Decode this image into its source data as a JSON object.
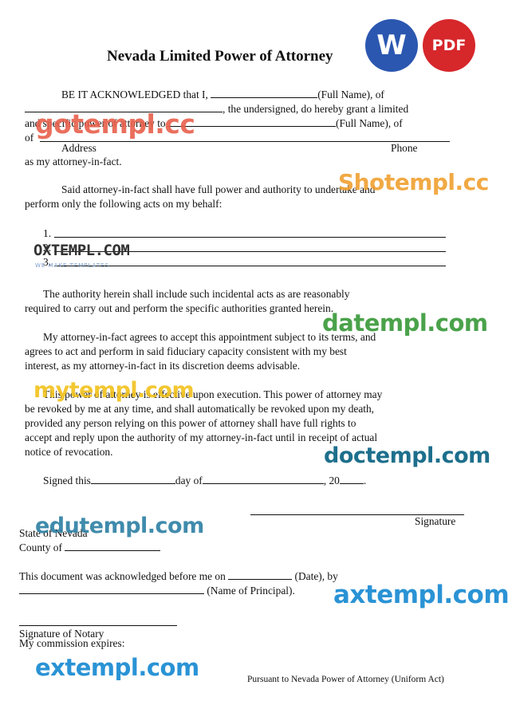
{
  "doc": {
    "title": "Nevada Limited Power of Attorney",
    "p1_a": "BE IT ACKNOWLEDGED   that I,",
    "p1_b": "(Full Name), of",
    "p1_c": ", the undersigned, do hereby grant a limited",
    "p1_d": "and specific power of attorney to",
    "p1_e": "(Full Name), of",
    "p1_f": "of",
    "address": "Address",
    "phone": "Phone",
    "p1_g": "as my attorney-in-fact.",
    "p2_a": "Said attorney-in-fact shall have full power and authority to undertake and",
    "p2_b": "perform only the following acts on my behalf:",
    "item1": "1.",
    "item2": "2.",
    "item3": "3.",
    "p3_a": "The authority herein shall include such incidental acts as are reasonably",
    "p3_b": "required to carry out and perform the specific authorities granted herein.",
    "p4_a": "My attorney-in-fact agrees to accept this appointment subject to its terms, and",
    "p4_b": "agrees to act and perform in said fiduciary capacity consistent with my best",
    "p4_c": "interest, as my attorney-in-fact in its discretion deems advisable.",
    "p5_a": "This power of attorney is effective upon execution. This power of attorney may",
    "p5_b": "be revoked by me at any time, and shall automatically be revoked upon my death,",
    "p5_c": "provided any person relying on this power of attorney shall have full rights to",
    "p5_d": "accept and reply upon the authority of my attorney-in-fact until in receipt of actual",
    "p5_e": "notice of revocation.",
    "signed_a": "Signed this",
    "signed_b": "day of",
    "signed_c": ", 20",
    "signed_d": ".",
    "signature": "Signature",
    "state": "State of Nevada",
    "county": "County of",
    "ack_a": "This document was acknowledged before me on",
    "ack_b": "(Date), by",
    "ack_c": "(Name of Principal).",
    "notary_sig": "Signature of Notary",
    "commission": "My commission expires:",
    "footer": "Pursuant to Nevada Power of Attorney (Uniform Act)"
  },
  "badges": {
    "word": "W",
    "pdf": "PDF",
    "word_color": "#2b57b0",
    "pdf_color": "#d6272b"
  },
  "watermarks": {
    "gotempl": "gotempl.cc",
    "shotempl": "Shotempl.cc",
    "oxtempl": "OXTEMPL.COM",
    "oxtempl_sub": "WE MAKE TEMPLATES",
    "datempl": "datempl.com",
    "mytempl": "mytempl.com",
    "doctempl": "doctempl.com",
    "edutempl": "edutempl.com",
    "axtempl": "axtempl.com",
    "extempl": "extempl.com"
  }
}
